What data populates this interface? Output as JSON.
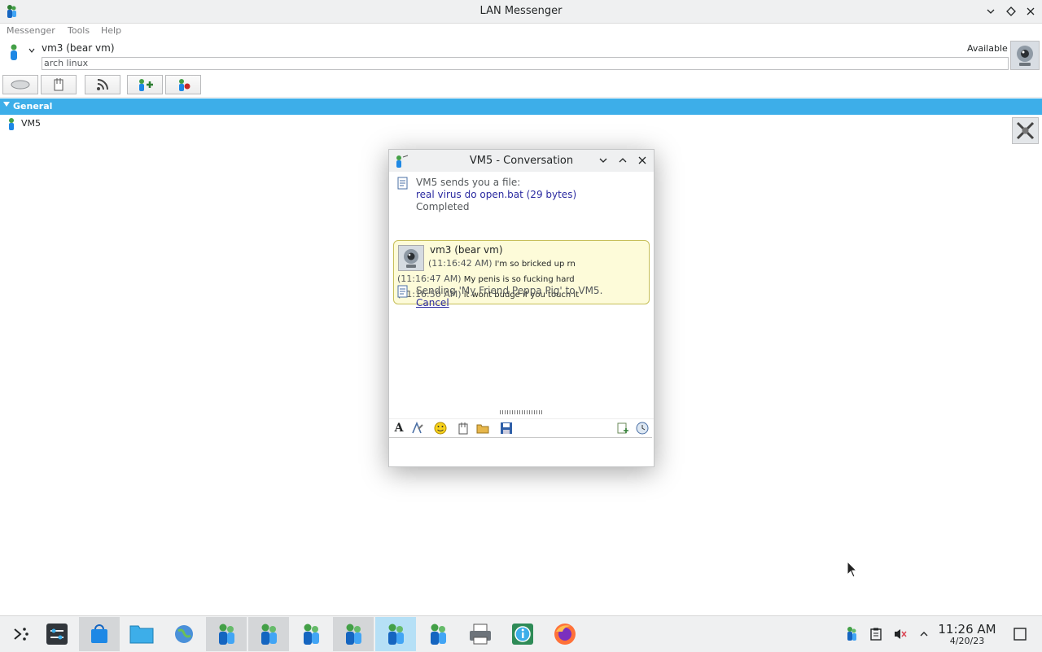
{
  "window": {
    "title": "LAN Messenger"
  },
  "menu": [
    "Messenger",
    "Tools",
    "Help"
  ],
  "user": {
    "name": "vm3 (bear vm)",
    "note": "arch linux",
    "status": "Available"
  },
  "group": {
    "name": "General",
    "contacts": [
      "VM5"
    ]
  },
  "conversation": {
    "title": "VM5 - Conversation",
    "file_notice": "VM5 sends you a file:",
    "file_link": "real virus do open.bat (29 bytes)",
    "file_status": "Completed",
    "sender": "vm3 (bear vm)",
    "messages": [
      {
        "time": "(11:16:42 AM)",
        "text": "I'm so bricked up rn"
      },
      {
        "time": "(11:16:47 AM)",
        "text": "My penis is so fucking hard"
      },
      {
        "time": "(11:16:50 AM)",
        "text": "it wont budge if you touch it"
      }
    ],
    "sending_notice": "Sending 'My Friend Peppa Pig' to VM5.",
    "cancel_label": "Cancel",
    "font_tool": "A"
  },
  "clock": {
    "time": "11:26 AM",
    "date": "4/20/23"
  },
  "colors": {
    "accent": "#3daee9",
    "bubble": "#fdfbd9",
    "link": "#2a2aa0"
  }
}
